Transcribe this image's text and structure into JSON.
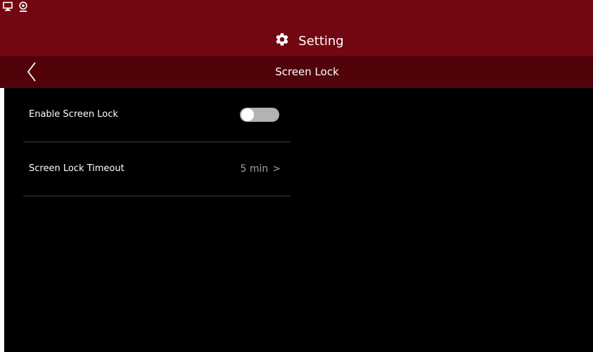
{
  "colors": {
    "header_bg": "#730711",
    "subheader_bg": "#52030a",
    "content_bg": "#000000",
    "text": "#ffffff",
    "muted_text": "#a0a0a0",
    "toggle_off": "#b3b3b3"
  },
  "status_bar": {
    "icons": [
      "monitor-icon",
      "webcam-icon"
    ]
  },
  "header": {
    "icon": "gear-icon",
    "title": "Setting"
  },
  "subheader": {
    "back_icon": "chevron-left-icon",
    "title": "Screen Lock"
  },
  "settings": {
    "enable_screen_lock": {
      "label": "Enable Screen Lock",
      "enabled": false
    },
    "screen_lock_timeout": {
      "label": "Screen Lock Timeout",
      "value": "5 min",
      "chevron": ">"
    }
  }
}
